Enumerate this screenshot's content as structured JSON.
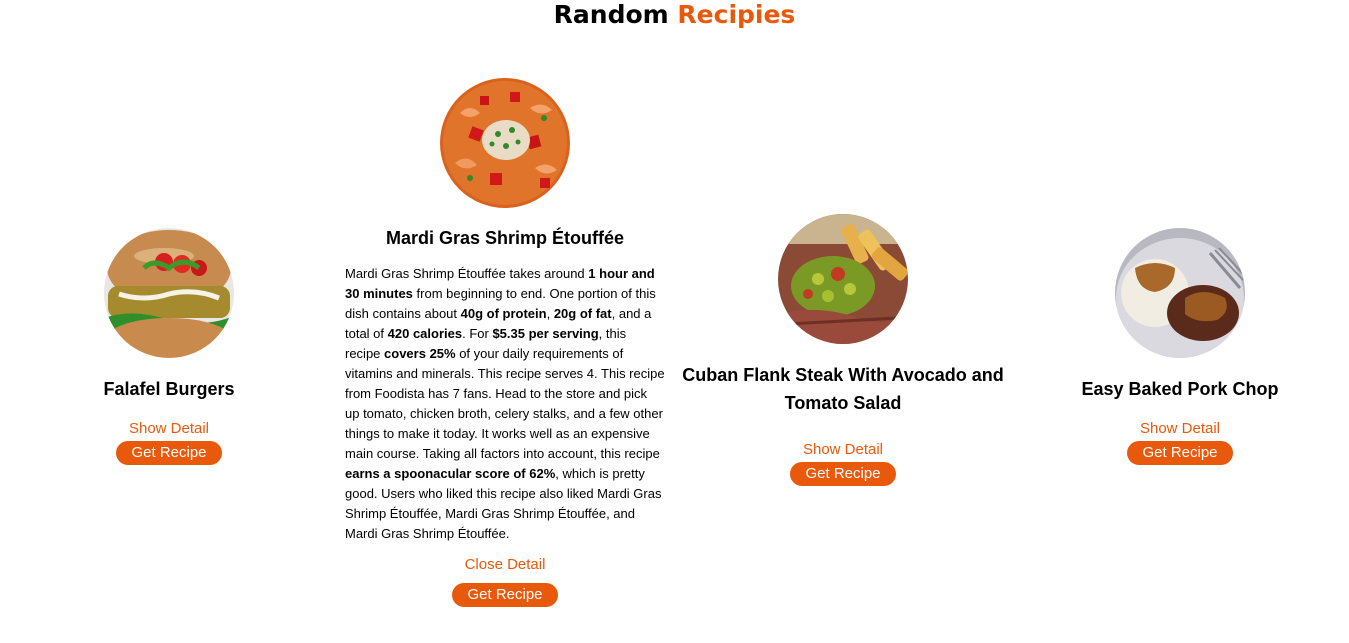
{
  "header": {
    "title_part1": "Random ",
    "title_part2": "Recipies",
    "accent_color": "#e8590c"
  },
  "recipes": [
    {
      "title": "Falafel Burgers",
      "image_icon": "falafel-burger-photo",
      "detail_link": "Show Detail",
      "cta": "Get Recipe"
    },
    {
      "title": "Mardi Gras Shrimp Étouffée",
      "image_icon": "shrimp-etouffee-photo",
      "detail_link": "Close Detail",
      "cta": "Get Recipe",
      "description": {
        "t1": "Mardi Gras Shrimp Étouffée takes around ",
        "b1": "1 hour and 30 minutes",
        "t2": " from beginning to end. One portion of this dish contains about ",
        "b2": "40g of protein",
        "t3": ", ",
        "b3": "20g of fat",
        "t4": ", and a total of ",
        "b4": "420 calories",
        "t5": ". For ",
        "b5": "$5.35 per serving",
        "t6": ", this recipe ",
        "b6": "covers 25%",
        "t7": " of your daily requirements of vitamins and minerals. This recipe serves 4. This recipe from Foodista has 7 fans. Head to the store and pick up tomato, chicken broth, celery stalks, and a few other things to make it today. It works well as an expensive main course. Taking all factors into account, this recipe ",
        "b7": "earns a spoonacular score of 62%",
        "t8": ", which is pretty good. Users who liked this recipe also liked Mardi Gras Shrimp Étouffée, Mardi Gras Shrimp Étouffée, and Mardi Gras Shrimp Étouffée."
      }
    },
    {
      "title": "Cuban Flank Steak With Avocado and Tomato Salad",
      "image_icon": "flank-steak-photo",
      "detail_link": "Show Detail",
      "cta": "Get Recipe"
    },
    {
      "title": "Easy Baked Pork Chop",
      "image_icon": "pork-chop-photo",
      "detail_link": "Show Detail",
      "cta": "Get Recipe"
    }
  ]
}
